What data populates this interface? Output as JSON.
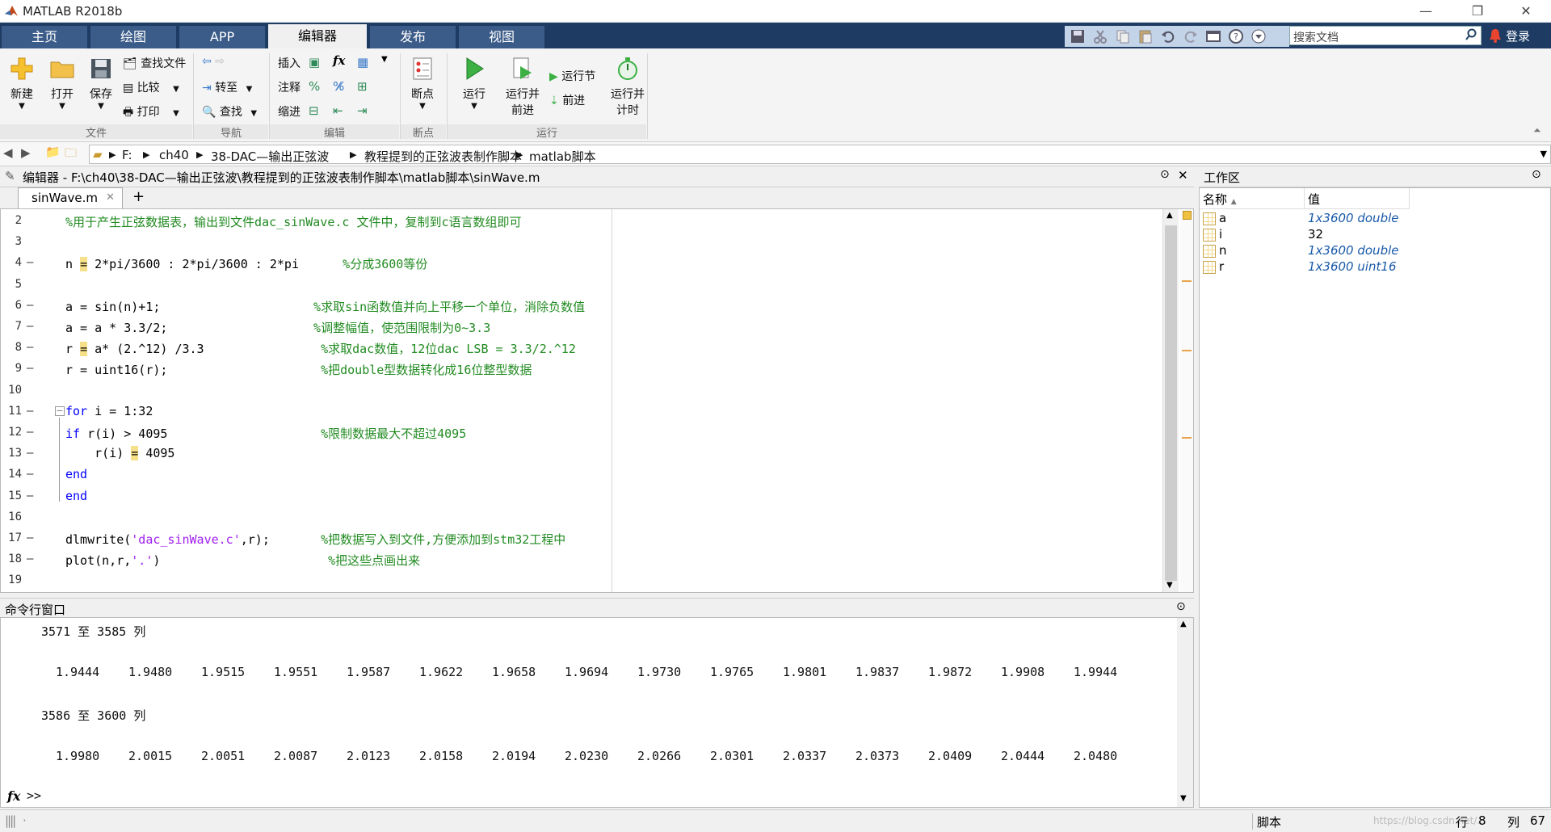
{
  "window": {
    "title": "MATLAB R2018b",
    "minimize": "—",
    "restore": "❐",
    "close": "✕"
  },
  "tabs": [
    "主页",
    "绘图",
    "APP",
    "编辑器",
    "发布",
    "视图"
  ],
  "active_tab": "编辑器",
  "search": {
    "placeholder": "搜索文档"
  },
  "login": "登录",
  "ribbon": {
    "file": {
      "new": "新建",
      "open": "打开",
      "save": "保存",
      "find_file": "查找文件",
      "compare": "比较",
      "print": "打印",
      "group": "文件"
    },
    "nav": {
      "goto": "转至",
      "find": "查找",
      "group": "导航"
    },
    "edit": {
      "insert": "插入",
      "comment": "注释",
      "indent": "缩进",
      "group": "编辑"
    },
    "breakpoints": {
      "label": "断点",
      "group": "断点"
    },
    "run": {
      "run": "运行",
      "run_advance_1": "运行并",
      "run_advance_2": "前进",
      "run_section": "运行节",
      "advance": "前进",
      "run_time_1": "运行并",
      "run_time_2": "计时",
      "group": "运行"
    }
  },
  "address": {
    "crumbs": [
      "F:",
      "ch40",
      "38-DAC—输出正弦波",
      "教程提到的正弦波表制作脚本",
      "matlab脚本"
    ]
  },
  "editor": {
    "title": "编辑器 - F:\\ch40\\38-DAC—输出正弦波\\教程提到的正弦波表制作脚本\\matlab脚本\\sinWave.m",
    "tab": "sinWave.m",
    "add_tab": "+",
    "lines": [
      {
        "n": "2",
        "dash": "",
        "code": "%用于产生正弦数据表，输出到文件dac_sinWave.c 文件中，复制到c语言数组即可"
      },
      {
        "n": "3",
        "dash": "",
        "code": ""
      },
      {
        "n": "4",
        "dash": "—",
        "pre": "n ",
        "hl": "=",
        "post": " 2*pi/3600 : 2*pi/3600 : 2*pi      ",
        "comment": "%分成3600等份"
      },
      {
        "n": "5",
        "dash": "",
        "code": ""
      },
      {
        "n": "6",
        "dash": "—",
        "pre": "a = sin(n)+1;                     ",
        "comment": "%求取sin函数值并向上平移一个单位，消除负数值"
      },
      {
        "n": "7",
        "dash": "—",
        "pre": "a = a * 3.3/2;                    ",
        "comment": "%调整幅值，使范围限制为0~3.3"
      },
      {
        "n": "8",
        "dash": "—",
        "pre": "r ",
        "hl": "=",
        "post": " a* (2.^12) /3.3                ",
        "comment": "%求取dac数值，12位dac LSB = 3.3/2.^12"
      },
      {
        "n": "9",
        "dash": "—",
        "pre": "r = uint16(r);                     ",
        "comment": "%把double型数据转化成16位整型数据"
      },
      {
        "n": "10",
        "dash": "",
        "code": ""
      },
      {
        "n": "11",
        "dash": "—",
        "kw": "for",
        "pre": " i = 1:32"
      },
      {
        "n": "12",
        "dash": "—",
        "kw": "if",
        "pre": " r(i) > 4095                     ",
        "comment": "%限制数据最大不超过4095"
      },
      {
        "n": "13",
        "dash": "—",
        "pre": "    r(i) ",
        "hl": "=",
        "post": " 4095"
      },
      {
        "n": "14",
        "dash": "—",
        "kw": "end",
        "pre": ""
      },
      {
        "n": "15",
        "dash": "—",
        "kw": "end",
        "pre": ""
      },
      {
        "n": "16",
        "dash": "",
        "code": ""
      },
      {
        "n": "17",
        "dash": "—",
        "pre": "dlmwrite(",
        "str": "'dac_sinWave.c'",
        "post": ",r);       ",
        "comment": "%把数据写入到文件,方便添加到stm32工程中"
      },
      {
        "n": "18",
        "dash": "—",
        "pre": "plot(n,r,",
        "str": "'.'",
        "post": ")                       ",
        "comment": "%把这些点画出来"
      },
      {
        "n": "19",
        "dash": "",
        "code": ""
      }
    ]
  },
  "command": {
    "title": "命令行窗口",
    "block1_header": "3571 至 3585 列",
    "block1_values": [
      "1.9444",
      "1.9480",
      "1.9515",
      "1.9551",
      "1.9587",
      "1.9622",
      "1.9658",
      "1.9694",
      "1.9730",
      "1.9765",
      "1.9801",
      "1.9837",
      "1.9872",
      "1.9908",
      "1.9944"
    ],
    "block2_header": "3586 至 3600 列",
    "block2_values": [
      "1.9980",
      "2.0015",
      "2.0051",
      "2.0087",
      "2.0123",
      "2.0158",
      "2.0194",
      "2.0230",
      "2.0266",
      "2.0301",
      "2.0337",
      "2.0373",
      "2.0409",
      "2.0444",
      "2.0480"
    ],
    "prompt": ">>",
    "fx": "fx"
  },
  "workspace": {
    "title": "工作区",
    "col_name": "名称",
    "col_value": "值",
    "vars": [
      {
        "name": "a",
        "value": "1x3600 double",
        "italic": true
      },
      {
        "name": "i",
        "value": "32",
        "italic": false
      },
      {
        "name": "n",
        "value": "1x3600 double",
        "italic": true
      },
      {
        "name": "r",
        "value": "1x3600 uint16",
        "italic": true
      }
    ]
  },
  "status": {
    "mode": "脚本",
    "row_label": "行",
    "row": "8",
    "col_label": "列",
    "col": "67",
    "watermark": "https://blog.csdn.net/..."
  },
  "colors": {
    "tabbar": "#1d3b63",
    "tab": "#3b5b88",
    "comment": "#228b22",
    "keyword": "#0000ff",
    "string": "#a020f0"
  }
}
